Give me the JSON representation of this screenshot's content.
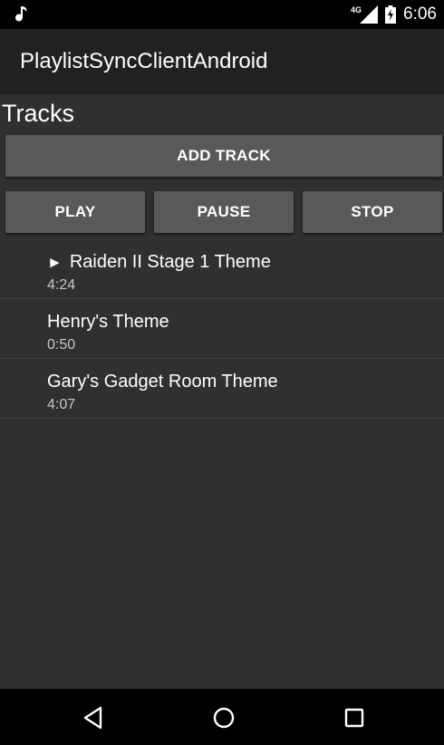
{
  "status_bar": {
    "network": "4G",
    "time": "6:06",
    "icons": [
      "music-note-icon",
      "signal-icon",
      "battery-charging-icon"
    ]
  },
  "action_bar": {
    "title": "PlaylistSyncClientAndroid"
  },
  "section": {
    "title": "Tracks"
  },
  "buttons": {
    "add_track": "ADD TRACK",
    "play": "PLAY",
    "pause": "PAUSE",
    "stop": "STOP"
  },
  "tracks": [
    {
      "indicator": "►",
      "title": "Raiden II Stage 1 Theme",
      "duration": "4:24"
    },
    {
      "indicator": "",
      "title": "Henry's Theme",
      "duration": "0:50"
    },
    {
      "indicator": "",
      "title": "Gary's Gadget Room Theme",
      "duration": "4:07"
    }
  ],
  "nav_bar": {
    "icons": [
      "back-icon",
      "home-icon",
      "recents-icon"
    ]
  },
  "colors": {
    "background": "#303030",
    "action_bar": "#212121",
    "status_bar": "#000000",
    "button": "#595959",
    "text": "#ffffff",
    "secondary_text": "#c8c8c8"
  }
}
